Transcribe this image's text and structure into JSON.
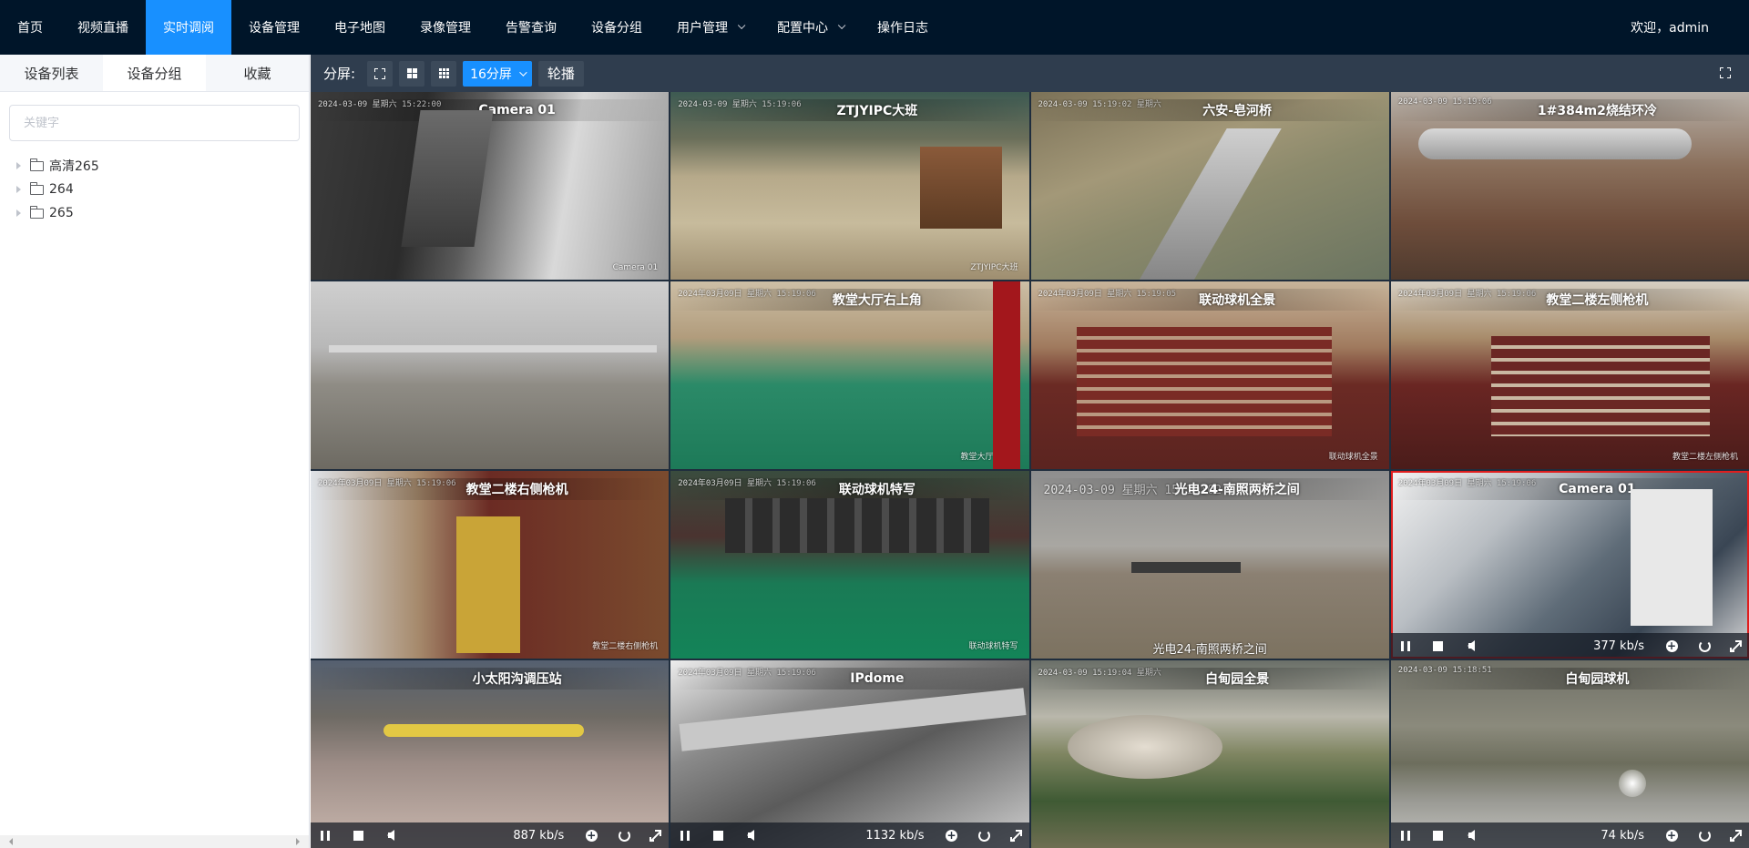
{
  "nav": {
    "items": [
      {
        "label": "首页",
        "active": false,
        "dropdown": false
      },
      {
        "label": "视频直播",
        "active": false,
        "dropdown": false
      },
      {
        "label": "实时调阅",
        "active": true,
        "dropdown": false
      },
      {
        "label": "设备管理",
        "active": false,
        "dropdown": false
      },
      {
        "label": "电子地图",
        "active": false,
        "dropdown": false
      },
      {
        "label": "录像管理",
        "active": false,
        "dropdown": false
      },
      {
        "label": "告警查询",
        "active": false,
        "dropdown": false
      },
      {
        "label": "设备分组",
        "active": false,
        "dropdown": false
      },
      {
        "label": "用户管理",
        "active": false,
        "dropdown": true
      },
      {
        "label": "配置中心",
        "active": false,
        "dropdown": true
      },
      {
        "label": "操作日志",
        "active": false,
        "dropdown": false
      }
    ],
    "welcome": "欢迎，admin",
    "colors": {
      "bar": "#001529",
      "active": "#1890ff"
    }
  },
  "sidebar": {
    "tabs": [
      {
        "label": "设备列表",
        "active": false
      },
      {
        "label": "设备分组",
        "active": true
      },
      {
        "label": "收藏",
        "active": false
      }
    ],
    "search_placeholder": "关键字",
    "tree": [
      {
        "label": "高清265",
        "icon": "folder-icon"
      },
      {
        "label": "264",
        "icon": "folder-icon"
      },
      {
        "label": "265",
        "icon": "folder-icon"
      }
    ]
  },
  "toolbar": {
    "split_label": "分屏:",
    "layout_select": "16分屏",
    "carousel": "轮播"
  },
  "cameras": [
    {
      "title": "Camera 01",
      "osd_time": "2024-03-09 星期六 15:22:00",
      "osd_name": "Camera 01",
      "osd_bottom": "",
      "controls": false,
      "rate": "",
      "selected": false
    },
    {
      "title": "ZTJYIPC大班",
      "osd_time": "2024-03-09 星期六 15:19:06",
      "osd_name": "ZTJYIPC大班",
      "osd_bottom": "",
      "controls": false,
      "rate": "",
      "selected": false
    },
    {
      "title": "六安-皂河桥",
      "osd_time": "2024-03-09 15:19:02 星期六",
      "osd_name": "",
      "osd_bottom": "",
      "controls": false,
      "rate": "",
      "selected": false
    },
    {
      "title": "1#384m2烧结环冷",
      "osd_time": "2024-03-09 15:19:06",
      "osd_name": "",
      "osd_bottom": "",
      "controls": false,
      "rate": "",
      "selected": false
    },
    {
      "title": "",
      "osd_time": "",
      "osd_name": "",
      "osd_bottom": "",
      "controls": false,
      "rate": "",
      "selected": false
    },
    {
      "title": "教堂大厅右上角",
      "osd_time": "2024年03月09日 星期六 15:19:06",
      "osd_name": "教堂大厅右上角",
      "osd_bottom": "",
      "controls": false,
      "rate": "",
      "selected": false
    },
    {
      "title": "联动球机全景",
      "osd_time": "2024年03月09日 星期六 15:19:05",
      "osd_name": "联动球机全景",
      "osd_bottom": "",
      "controls": false,
      "rate": "",
      "selected": false
    },
    {
      "title": "教堂二楼左侧枪机",
      "osd_time": "2024年03月09日 星期六 15:19:06",
      "osd_name": "教堂二楼左侧枪机",
      "osd_bottom": "",
      "controls": false,
      "rate": "",
      "selected": false
    },
    {
      "title": "教堂二楼右侧枪机",
      "osd_time": "2024年03月09日 星期六 15:19:06",
      "osd_name": "教堂二楼右侧枪机",
      "osd_bottom": "",
      "controls": false,
      "rate": "",
      "selected": false
    },
    {
      "title": "联动球机特写",
      "osd_time": "2024年03月09日 星期六 15:19:06",
      "osd_name": "联动球机特写",
      "osd_bottom": "",
      "controls": false,
      "rate": "",
      "selected": false
    },
    {
      "title": "光电24-南照两桥之间",
      "osd_time": "2024-03-09 星期六 15:19:02",
      "osd_name": "",
      "osd_bottom": "光电24-南照两桥之间",
      "controls": false,
      "rate": "",
      "selected": false,
      "big_time": true
    },
    {
      "title": "Camera 01",
      "osd_time": "2024年03月09日 星期六 15:19:06",
      "osd_name": "",
      "osd_bottom": "",
      "controls": true,
      "rate": "377 kb/s",
      "selected": true
    },
    {
      "title": "小太阳沟调压站",
      "osd_time": "",
      "osd_name": "",
      "osd_bottom": "",
      "controls": true,
      "rate": "887 kb/s",
      "selected": false
    },
    {
      "title": "IPdome",
      "osd_time": "2024年03月09日 星期六 15:19:06",
      "osd_name": "",
      "osd_bottom": "",
      "controls": true,
      "rate": "1132 kb/s",
      "selected": false
    },
    {
      "title": "白甸园全景",
      "osd_time": "2024-03-09 15:19:04 星期六",
      "osd_name": "",
      "osd_bottom": "",
      "controls": false,
      "rate": "",
      "selected": false
    },
    {
      "title": "白甸园球机",
      "osd_time": "2024-03-09 15:18:51",
      "osd_name": "",
      "osd_bottom": "",
      "controls": true,
      "rate": "74 kb/s",
      "selected": false
    }
  ]
}
